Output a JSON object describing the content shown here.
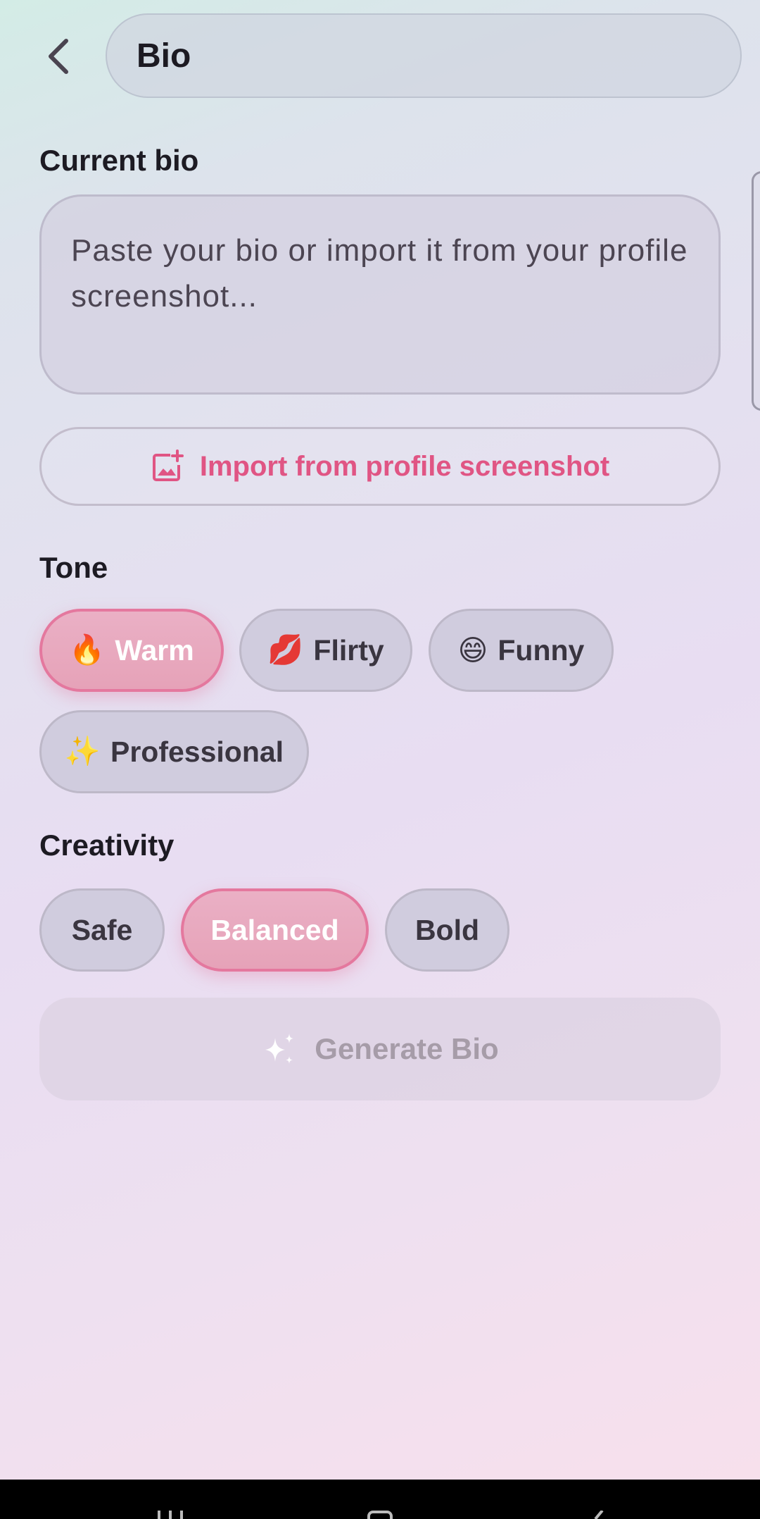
{
  "header": {
    "title": "Bio"
  },
  "current_bio": {
    "label": "Current bio",
    "placeholder": "Paste your bio or import it from your profile screenshot...",
    "value": ""
  },
  "import_button": {
    "label": "Import from profile screenshot",
    "icon": "add-photo-icon"
  },
  "tone": {
    "label": "Tone",
    "options": [
      {
        "emoji": "🔥",
        "label": "Warm",
        "selected": true
      },
      {
        "emoji": "💋",
        "label": "Flirty",
        "selected": false
      },
      {
        "emoji": "😄",
        "label": "Funny",
        "selected": false
      },
      {
        "emoji": "✨",
        "label": "Professional",
        "selected": false
      }
    ]
  },
  "creativity": {
    "label": "Creativity",
    "options": [
      {
        "label": "Safe",
        "selected": false
      },
      {
        "label": "Balanced",
        "selected": true
      },
      {
        "label": "Bold",
        "selected": false
      }
    ]
  },
  "generate_button": {
    "label": "Generate Bio",
    "icon": "sparkles-icon",
    "enabled": false
  },
  "colors": {
    "accent": "#e05584",
    "selected_chip": "#e6a2b8",
    "chip_border_selected": "#e4789e"
  }
}
